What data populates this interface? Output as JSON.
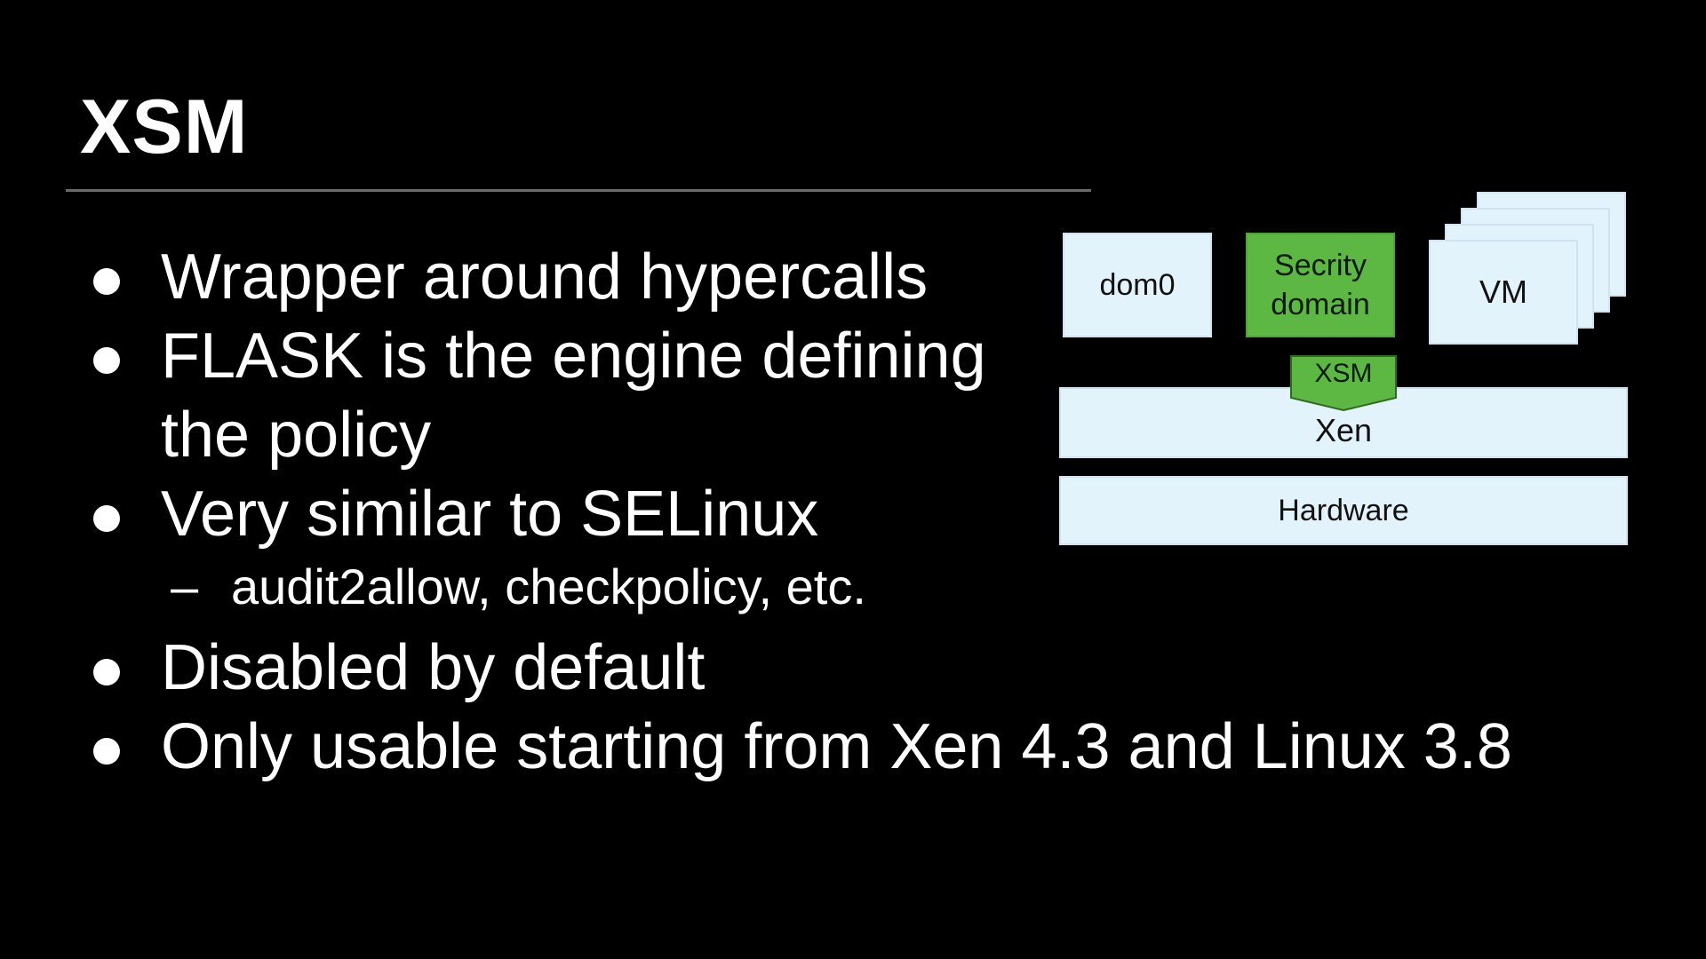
{
  "slide": {
    "title": "XSM",
    "bullets": [
      {
        "text": "Wrapper around hypercalls"
      },
      {
        "text": "FLASK is the engine defining"
      },
      {
        "text": "the policy"
      },
      {
        "text": "Very similar to SELinux"
      },
      {
        "text": "Disabled by default"
      },
      {
        "text": "Only usable starting from Xen 4.3 and Linux 3.8"
      }
    ],
    "sub_bullet": {
      "dash": "–",
      "text": "audit2allow, checkpolicy, etc."
    }
  },
  "diagram": {
    "dom0": "dom0",
    "security_domain_line1": "Secrity",
    "security_domain_line2": "domain",
    "vm": "VM",
    "xsm": "XSM",
    "xen": "Xen",
    "hardware": "Hardware",
    "colors": {
      "box_fill": "#e3f3fb",
      "green_fill": "#5cb843"
    }
  }
}
